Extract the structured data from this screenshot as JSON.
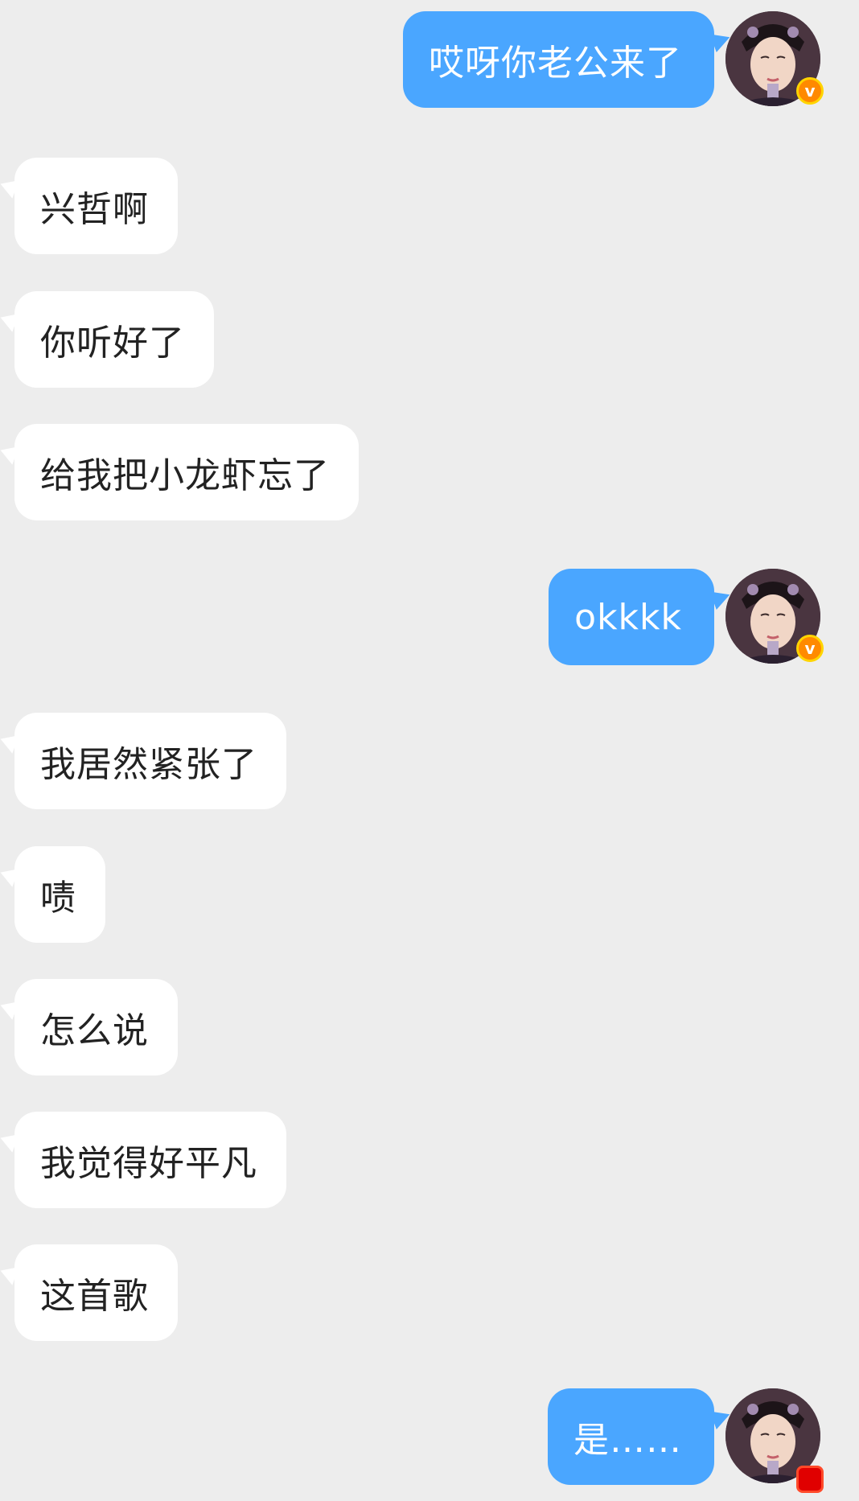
{
  "messages": [
    {
      "side": "out",
      "text": "哎呀你老公来了",
      "verified_badge": "v"
    },
    {
      "side": "in",
      "text": "兴哲啊"
    },
    {
      "side": "in",
      "text": "你听好了"
    },
    {
      "side": "in",
      "text": "给我把小龙虾忘了"
    },
    {
      "side": "out",
      "text": "okkkk",
      "verified_badge": "v"
    },
    {
      "side": "in",
      "text": "我居然紧张了"
    },
    {
      "side": "in",
      "text": "啧"
    },
    {
      "side": "in",
      "text": "怎么说"
    },
    {
      "side": "in",
      "text": "我觉得好平凡"
    },
    {
      "side": "in",
      "text": "这首歌"
    },
    {
      "side": "out",
      "text": "是……"
    }
  ],
  "colors": {
    "background": "#ededed",
    "incoming_bubble": "#ffffff",
    "outgoing_bubble": "#4aa6ff",
    "badge": "#ff8a00"
  },
  "icons": {
    "avatar": "user-avatar",
    "badge": "verified-v-badge-icon"
  }
}
